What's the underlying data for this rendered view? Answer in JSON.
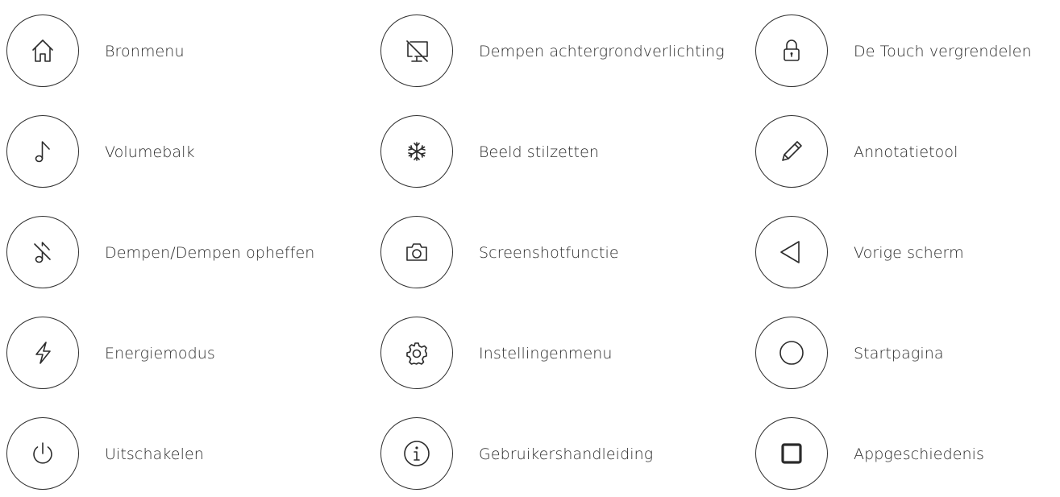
{
  "icon_color": "#2b2b2b",
  "items": [
    {
      "icon": "home-icon",
      "label": "Bronmenu"
    },
    {
      "icon": "monitor-off-icon",
      "label": "Dempen achtergrondverlichting"
    },
    {
      "icon": "lock-icon",
      "label": "De Touch vergrendelen"
    },
    {
      "icon": "music-note-icon",
      "label": "Volumebalk"
    },
    {
      "icon": "snowflake-icon",
      "label": "Beeld stilzetten"
    },
    {
      "icon": "pencil-icon",
      "label": "Annotatietool"
    },
    {
      "icon": "music-note-off-icon",
      "label": "Dempen/Dempen opheffen"
    },
    {
      "icon": "camera-icon",
      "label": "Screenshotfunctie"
    },
    {
      "icon": "triangle-back-icon",
      "label": "Vorige scherm"
    },
    {
      "icon": "lightning-icon",
      "label": "Energiemodus"
    },
    {
      "icon": "gear-icon",
      "label": "Instellingenmenu"
    },
    {
      "icon": "circle-home-icon",
      "label": "Startpagina"
    },
    {
      "icon": "power-icon",
      "label": "Uitschakelen"
    },
    {
      "icon": "info-icon",
      "label": "Gebruikershandleiding"
    },
    {
      "icon": "square-icon",
      "label": "Appgeschiedenis"
    }
  ]
}
